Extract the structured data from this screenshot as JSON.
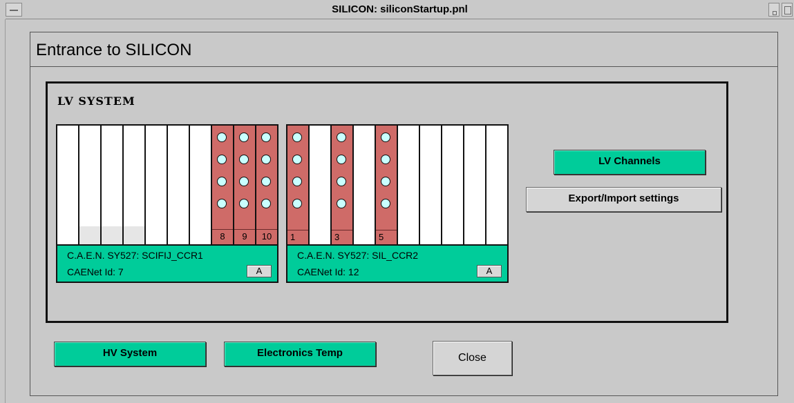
{
  "window": {
    "title": "SILICON: siliconStartup.pnl"
  },
  "page": {
    "title": "Entrance to SILICON"
  },
  "lv_system": {
    "title": "LV SYSTEM",
    "crates": [
      {
        "name": "C.A.E.N. SY527: SCIFIJ_CCR1",
        "id": "CAENet Id: 7",
        "button": "A",
        "slot_labels": [
          "8",
          "9",
          "10"
        ]
      },
      {
        "name": "C.A.E.N. SY527: SIL_CCR2",
        "id": "CAENet Id: 12",
        "button": "A",
        "slot_labels": [
          "1",
          "3",
          "5"
        ]
      }
    ]
  },
  "buttons": {
    "lv_channels": "LV Channels",
    "export_import": "Export/Import settings",
    "hv_system": "HV System",
    "electronics_temp": "Electronics Temp",
    "close": "Close"
  },
  "colors": {
    "background": "#c9c9c9",
    "accent_green": "#00cc9a",
    "slot_active": "#cf6b68",
    "led": "#c9ffff"
  }
}
